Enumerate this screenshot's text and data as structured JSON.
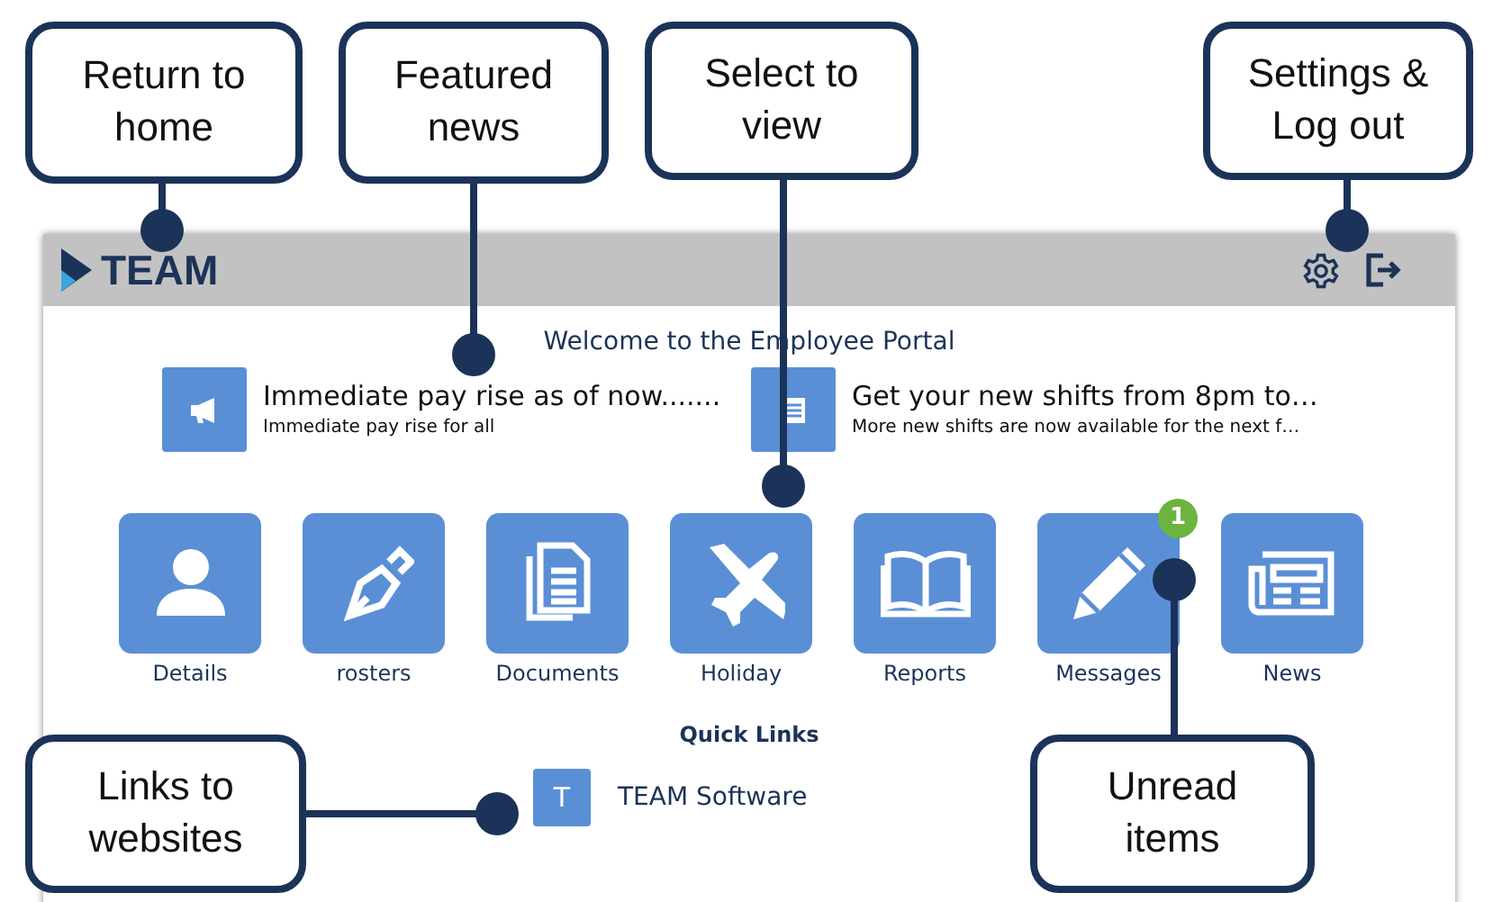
{
  "header": {
    "logo": "TEAM"
  },
  "welcome": "Welcome to the Employee Portal",
  "news": [
    {
      "kind": "announcement",
      "title": "Immediate pay rise as of now.......",
      "summary": "Immediate pay rise for all"
    },
    {
      "kind": "document",
      "title": "Get your new shifts from 8pm to…",
      "summary": "More new shifts are now available for the next f…"
    }
  ],
  "tiles": [
    {
      "kind": "person",
      "label": "Details"
    },
    {
      "kind": "pen",
      "label": "rosters"
    },
    {
      "kind": "documents",
      "label": "Documents"
    },
    {
      "kind": "plane",
      "label": "Holiday"
    },
    {
      "kind": "book",
      "label": "Reports"
    },
    {
      "kind": "pencil",
      "label": "Messages",
      "badge": "1"
    },
    {
      "kind": "newspaper",
      "label": "News"
    }
  ],
  "quick_links": {
    "title": "Quick Links",
    "items": [
      {
        "initial": "T",
        "label": "TEAM Software"
      }
    ]
  },
  "callouts": [
    {
      "text": "Return to\nhome"
    },
    {
      "text": "Featured\nnews"
    },
    {
      "text": "Select to\nview"
    },
    {
      "text": "Settings &\nLog out"
    },
    {
      "text": "Links to\nwebsites"
    },
    {
      "text": "Unread\nitems"
    }
  ]
}
